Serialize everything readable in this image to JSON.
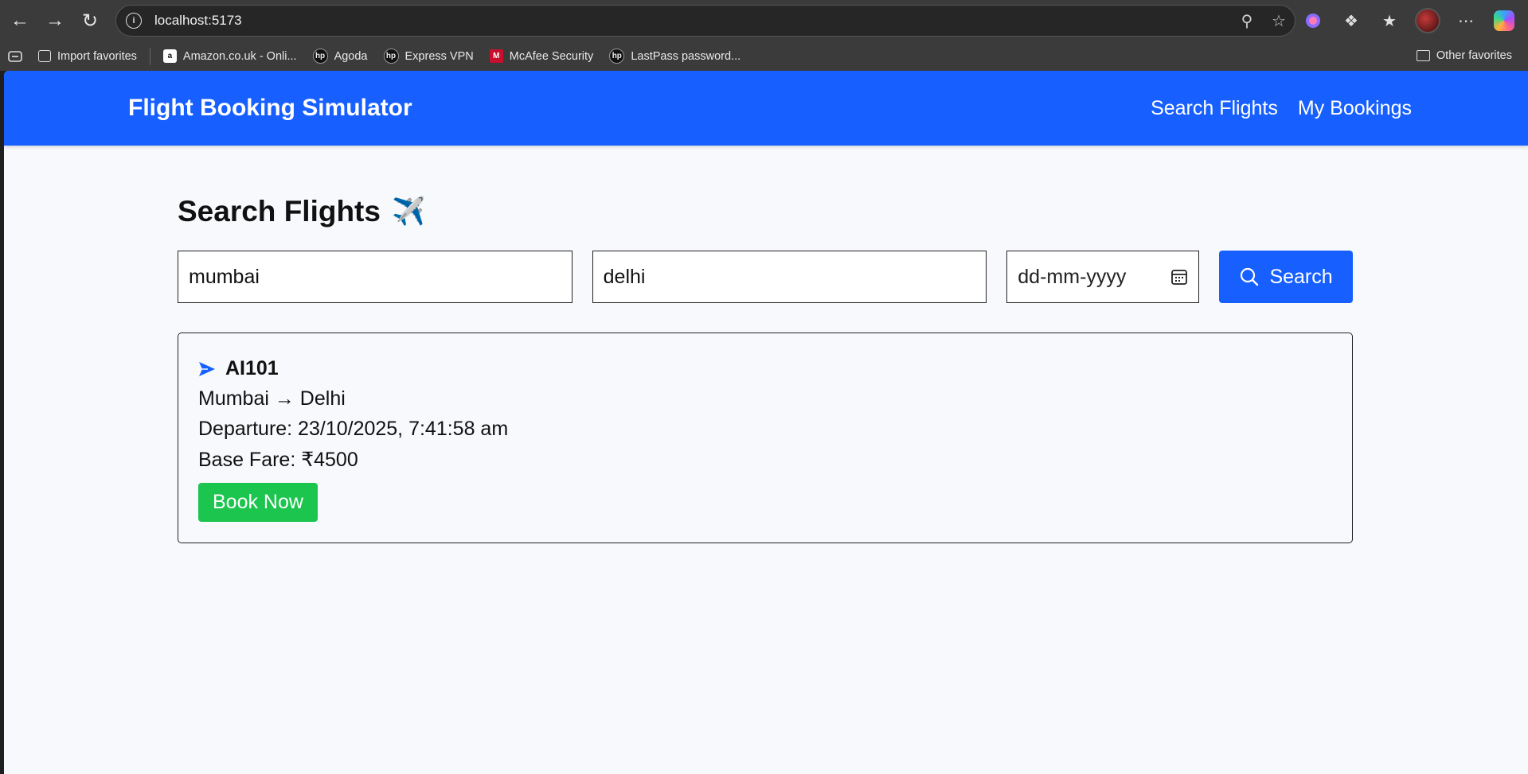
{
  "browser": {
    "url": "localhost:5173",
    "bookmarks": [
      {
        "label": "Import favorites",
        "icon": "import-icon"
      },
      {
        "label": "Amazon.co.uk - Onli...",
        "icon": "amazon-icon"
      },
      {
        "label": "Agoda",
        "icon": "hp-icon"
      },
      {
        "label": "Express VPN",
        "icon": "hp-icon"
      },
      {
        "label": "McAfee Security",
        "icon": "mcafee-icon"
      },
      {
        "label": "LastPass password...",
        "icon": "hp-icon"
      }
    ],
    "other_favorites": "Other favorites"
  },
  "navbar": {
    "brand": "Flight Booking Simulator",
    "links": [
      "Search Flights",
      "My Bookings"
    ]
  },
  "search": {
    "title": "Search Flights",
    "title_emoji": "✈️",
    "from_value": "mumbai",
    "to_value": "delhi",
    "date_placeholder": "dd-mm-yyyy",
    "button_label": "Search"
  },
  "results": [
    {
      "flight_no": "AI101",
      "route": "Mumbai → Delhi",
      "departure": "Departure: 23/10/2025, 7:41:58 am",
      "fare": "Base Fare: ₹4500",
      "book_label": "Book Now"
    }
  ],
  "colors": {
    "primary": "#1760ff",
    "book": "#1bc54e",
    "page_bg": "#f7f9fc"
  }
}
